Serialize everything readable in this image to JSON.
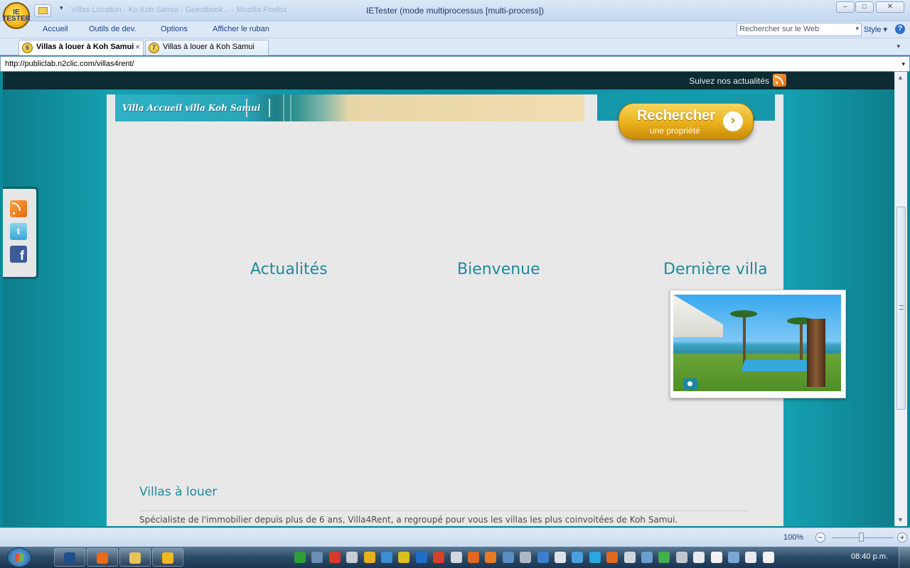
{
  "window": {
    "app_title": "IETester (mode multiprocessus [multi-process])",
    "ghost_title": "Villas Location - Ko Koh Samui - Guestbook... - Mozilla Firefox",
    "minimize": "–",
    "maximize": "□",
    "close": "✕",
    "logo_text": "IE TESTER"
  },
  "ribbon": {
    "tabs": [
      "Accueil",
      "Outils de dev.",
      "Options",
      "Afficher le ruban"
    ],
    "search_placeholder": "Rechercher sur le Web",
    "style_label": "Style",
    "help": "?"
  },
  "browser_tabs": [
    {
      "label": "Villas à louer à Koh Samui",
      "version": "6",
      "active": true
    },
    {
      "label": "Villas à louer à Koh Samui",
      "version": "7",
      "active": false
    }
  ],
  "address": {
    "url": "http://publiclab.n2clic.com/villas4rent/"
  },
  "page": {
    "top_link": "Suivez nos actualités",
    "banner_text": "Villa Accueil villa Koh Samui",
    "search_button": {
      "title": "Rechercher",
      "subtitle": "une propriété",
      "arrow": "›"
    },
    "sections": [
      "Actualités",
      "Bienvenue",
      "Dernière villa"
    ],
    "villas_title": "Villas à louer",
    "intro_text": "Spécialiste de l'immobilier depuis plus de 6 ans, Villa4Rent, a regroupé pour vous les villas les plus coinvoitées de Koh Samui.",
    "social": {
      "twitter": "t",
      "facebook": "f"
    }
  },
  "statusbar": {
    "zoom": "100%",
    "minus": "−",
    "plus": "+"
  },
  "taskbar": {
    "clock": "08:40 p.m.",
    "pinned": [
      {
        "name": "photoshop-task",
        "color": "#1d4f8a"
      },
      {
        "name": "firefox-task",
        "color": "#e86a1a"
      },
      {
        "name": "explorer-task",
        "color": "#e8c25a"
      },
      {
        "name": "ietester-task",
        "color": "#f0b81c"
      }
    ],
    "tray_colors": [
      "#2f9e3a",
      "#6a8fb3",
      "#d63a2a",
      "#c8cdd6",
      "#e8b020",
      "#3c8fd6",
      "#d8c020",
      "#1e6fc8",
      "#d64030",
      "#d4d8e0",
      "#e06820",
      "#e87a22",
      "#5b8ec4",
      "#b0b8c4",
      "#3a7fd0",
      "#dde3ea",
      "#49a0e0",
      "#2aa7e0",
      "#e06820",
      "#cfd6df",
      "#6aa0d0",
      "#3fb04a",
      "#c0c6cf",
      "#e6e9ee",
      "#f2f2f2",
      "#7aa8d6",
      "#e6e9ee",
      "#f2f2f2"
    ]
  }
}
